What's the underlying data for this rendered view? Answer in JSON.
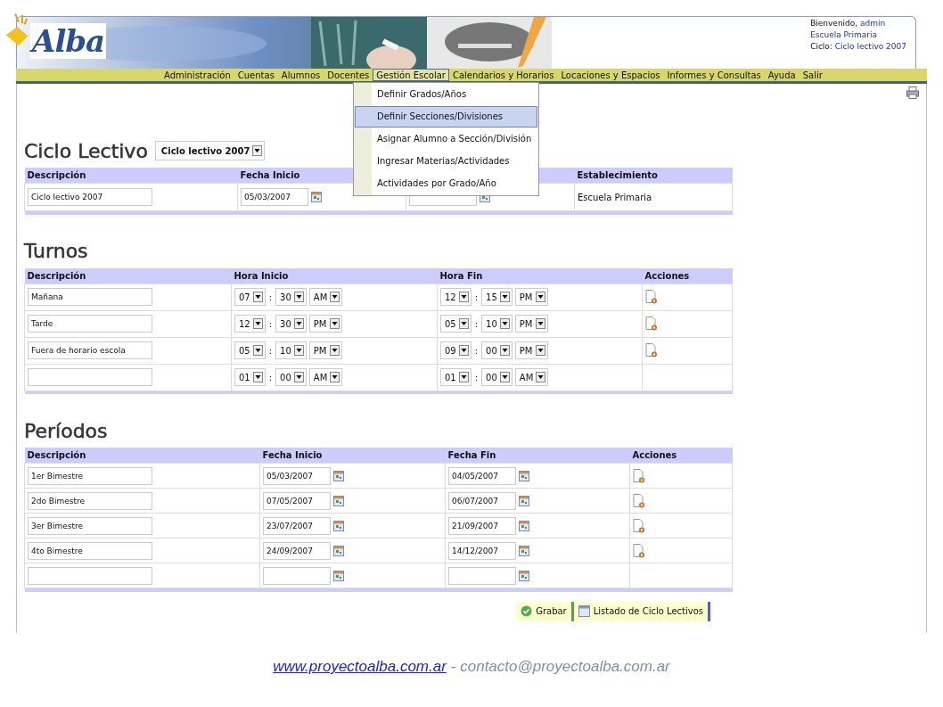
{
  "header": {
    "logo": "Alba",
    "welcome_label": "Bienvenido,",
    "user": "admin",
    "school": "Escuela Primaria",
    "cycle_label": "Ciclo:",
    "cycle": "Ciclo lectivo 2007"
  },
  "menu": [
    {
      "label": "Administración",
      "selected": false
    },
    {
      "label": "Cuentas",
      "selected": false
    },
    {
      "label": "Alumnos",
      "selected": false
    },
    {
      "label": "Docentes",
      "selected": false
    },
    {
      "label": "Gestión Escolar",
      "selected": true
    },
    {
      "label": "Calendarios y Horarios",
      "selected": false
    },
    {
      "label": "Locaciones y Espacios",
      "selected": false
    },
    {
      "label": "Informes y Consultas",
      "selected": false
    },
    {
      "label": "Ayuda",
      "selected": false
    },
    {
      "label": "Salir",
      "selected": false
    }
  ],
  "dropdown": [
    {
      "label": "Definir Grados/Años",
      "selected": false
    },
    {
      "label": "Definir Secciones/Divisiones",
      "selected": true
    },
    {
      "label": "Asignar Alumno a Sección/División",
      "selected": false
    },
    {
      "label": "Ingresar Materias/Actividades",
      "selected": false
    },
    {
      "label": "Actividades por Grado/Año",
      "selected": false
    }
  ],
  "ciclo": {
    "title": "Ciclo Lectivo",
    "selector": "Ciclo lectivo 2007",
    "columns": [
      {
        "label": "Descripción"
      },
      {
        "label": "Fecha Inicio"
      },
      {},
      {
        "label": "Establecimiento"
      }
    ],
    "row": {
      "descripcion": "Ciclo lectivo 2007",
      "fecha_inicio": "05/03/2007",
      "establecimiento": "Escuela Primaria"
    }
  },
  "turnos": {
    "title": "Turnos",
    "columns": [
      "Descripción",
      "Hora Inicio",
      "Hora Fin",
      "Acciones"
    ],
    "time_separator": ":",
    "rows": [
      {
        "descripcion": "Mañana",
        "inicio": [
          "07",
          "30",
          "AM"
        ],
        "fin": [
          "12",
          "15",
          "PM"
        ],
        "deletable": true
      },
      {
        "descripcion": "Tarde",
        "inicio": [
          "12",
          "30",
          "PM"
        ],
        "fin": [
          "05",
          "10",
          "PM"
        ],
        "deletable": true
      },
      {
        "descripcion": "Fuera de horario escola",
        "inicio": [
          "05",
          "10",
          "PM"
        ],
        "fin": [
          "09",
          "00",
          "PM"
        ],
        "deletable": true
      },
      {
        "inicio": [
          "01",
          "00",
          "AM"
        ],
        "fin": [
          "01",
          "00",
          "AM"
        ],
        "deletable": false
      }
    ]
  },
  "periodos": {
    "title": "Períodos",
    "columns": [
      "Descripción",
      "Fecha Inicio",
      "Fecha Fin",
      "Acciones"
    ],
    "rows": [
      {
        "descripcion": "1er Bimestre",
        "inicio": "05/03/2007",
        "fin": "04/05/2007",
        "deletable": true
      },
      {
        "descripcion": "2do Bimestre",
        "inicio": "07/05/2007",
        "fin": "06/07/2007",
        "deletable": true
      },
      {
        "descripcion": "3er Bimestre",
        "inicio": "23/07/2007",
        "fin": "21/09/2007",
        "deletable": true
      },
      {
        "descripcion": "4to Bimestre",
        "inicio": "24/09/2007",
        "fin": "14/12/2007",
        "deletable": true
      },
      {
        "deletable": false
      }
    ]
  },
  "buttons": [
    {
      "label": "Grabar",
      "kind": "save"
    },
    {
      "label": "Listado de Ciclo Lectivos",
      "kind": "list"
    }
  ],
  "footer": {
    "link": "www.proyectoalba.com.ar",
    "text": "- contacto@proyectoalba.com.ar"
  }
}
